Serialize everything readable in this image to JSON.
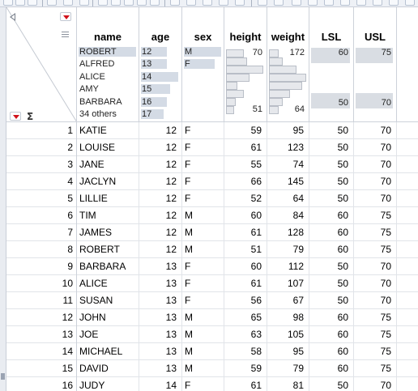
{
  "columns": {
    "name": "name",
    "age": "age",
    "sex": "sex",
    "height": "height",
    "weight": "weight",
    "lsl": "LSL",
    "usl": "USL"
  },
  "summary": {
    "name_levels": [
      {
        "label": "ROBERT",
        "fraction": 1.0
      },
      {
        "label": "ALFRED",
        "fraction": 0.0
      },
      {
        "label": "ALICE",
        "fraction": 0.0
      },
      {
        "label": "AMY",
        "fraction": 0.0
      },
      {
        "label": "BARBARA",
        "fraction": 0.0
      },
      {
        "label": "34 others",
        "fraction": 0.0
      }
    ],
    "age_levels": [
      {
        "label": "12",
        "fraction": 0.45
      },
      {
        "label": "13",
        "fraction": 0.45
      },
      {
        "label": "14",
        "fraction": 0.9
      },
      {
        "label": "15",
        "fraction": 0.55
      },
      {
        "label": "16",
        "fraction": 0.45
      },
      {
        "label": "17",
        "fraction": 0.4
      }
    ],
    "sex_levels": [
      {
        "label": "M",
        "fraction": 1.0
      },
      {
        "label": "F",
        "fraction": 0.85
      }
    ],
    "height_hist": {
      "max": "70",
      "min": "51",
      "bins": [
        0.45,
        0.55,
        0.95,
        0.6,
        0.3,
        0.45,
        0.25,
        0.2
      ]
    },
    "weight_hist": {
      "max": "172",
      "min": "64",
      "bins": [
        0.25,
        0.35,
        0.7,
        0.95,
        0.85,
        0.55,
        0.35,
        0.25
      ]
    },
    "lsl": {
      "max": "60",
      "min": "50"
    },
    "usl": {
      "max": "75",
      "min": "70"
    }
  },
  "rows": [
    {
      "n": "1",
      "name": "KATIE",
      "age": "12",
      "sex": "F",
      "height": "59",
      "weight": "95",
      "lsl": "50",
      "usl": "70"
    },
    {
      "n": "2",
      "name": "LOUISE",
      "age": "12",
      "sex": "F",
      "height": "61",
      "weight": "123",
      "lsl": "50",
      "usl": "70"
    },
    {
      "n": "3",
      "name": "JANE",
      "age": "12",
      "sex": "F",
      "height": "55",
      "weight": "74",
      "lsl": "50",
      "usl": "70"
    },
    {
      "n": "4",
      "name": "JACLYN",
      "age": "12",
      "sex": "F",
      "height": "66",
      "weight": "145",
      "lsl": "50",
      "usl": "70"
    },
    {
      "n": "5",
      "name": "LILLIE",
      "age": "12",
      "sex": "F",
      "height": "52",
      "weight": "64",
      "lsl": "50",
      "usl": "70"
    },
    {
      "n": "6",
      "name": "TIM",
      "age": "12",
      "sex": "M",
      "height": "60",
      "weight": "84",
      "lsl": "60",
      "usl": "75"
    },
    {
      "n": "7",
      "name": "JAMES",
      "age": "12",
      "sex": "M",
      "height": "61",
      "weight": "128",
      "lsl": "60",
      "usl": "75"
    },
    {
      "n": "8",
      "name": "ROBERT",
      "age": "12",
      "sex": "M",
      "height": "51",
      "weight": "79",
      "lsl": "60",
      "usl": "75"
    },
    {
      "n": "9",
      "name": "BARBARA",
      "age": "13",
      "sex": "F",
      "height": "60",
      "weight": "112",
      "lsl": "50",
      "usl": "70"
    },
    {
      "n": "10",
      "name": "ALICE",
      "age": "13",
      "sex": "F",
      "height": "61",
      "weight": "107",
      "lsl": "50",
      "usl": "70"
    },
    {
      "n": "11",
      "name": "SUSAN",
      "age": "13",
      "sex": "F",
      "height": "56",
      "weight": "67",
      "lsl": "50",
      "usl": "70"
    },
    {
      "n": "12",
      "name": "JOHN",
      "age": "13",
      "sex": "M",
      "height": "65",
      "weight": "98",
      "lsl": "60",
      "usl": "75"
    },
    {
      "n": "13",
      "name": "JOE",
      "age": "13",
      "sex": "M",
      "height": "63",
      "weight": "105",
      "lsl": "60",
      "usl": "75"
    },
    {
      "n": "14",
      "name": "MICHAEL",
      "age": "13",
      "sex": "M",
      "height": "58",
      "weight": "95",
      "lsl": "60",
      "usl": "75"
    },
    {
      "n": "15",
      "name": "DAVID",
      "age": "13",
      "sex": "M",
      "height": "59",
      "weight": "79",
      "lsl": "60",
      "usl": "75"
    },
    {
      "n": "16",
      "name": "JUDY",
      "age": "14",
      "sex": "F",
      "height": "61",
      "weight": "81",
      "lsl": "50",
      "usl": "70"
    }
  ],
  "colors": {
    "accent_red": "#d0121b",
    "summary_bar": "#d4dbe5",
    "grid_line": "#e1e4e9"
  },
  "icons": {
    "corner_menu": "red-triangle-menu-icon",
    "sigma": "sigma-icon",
    "collapse": "back-triangle-icon"
  },
  "sigma_label": "Σ"
}
